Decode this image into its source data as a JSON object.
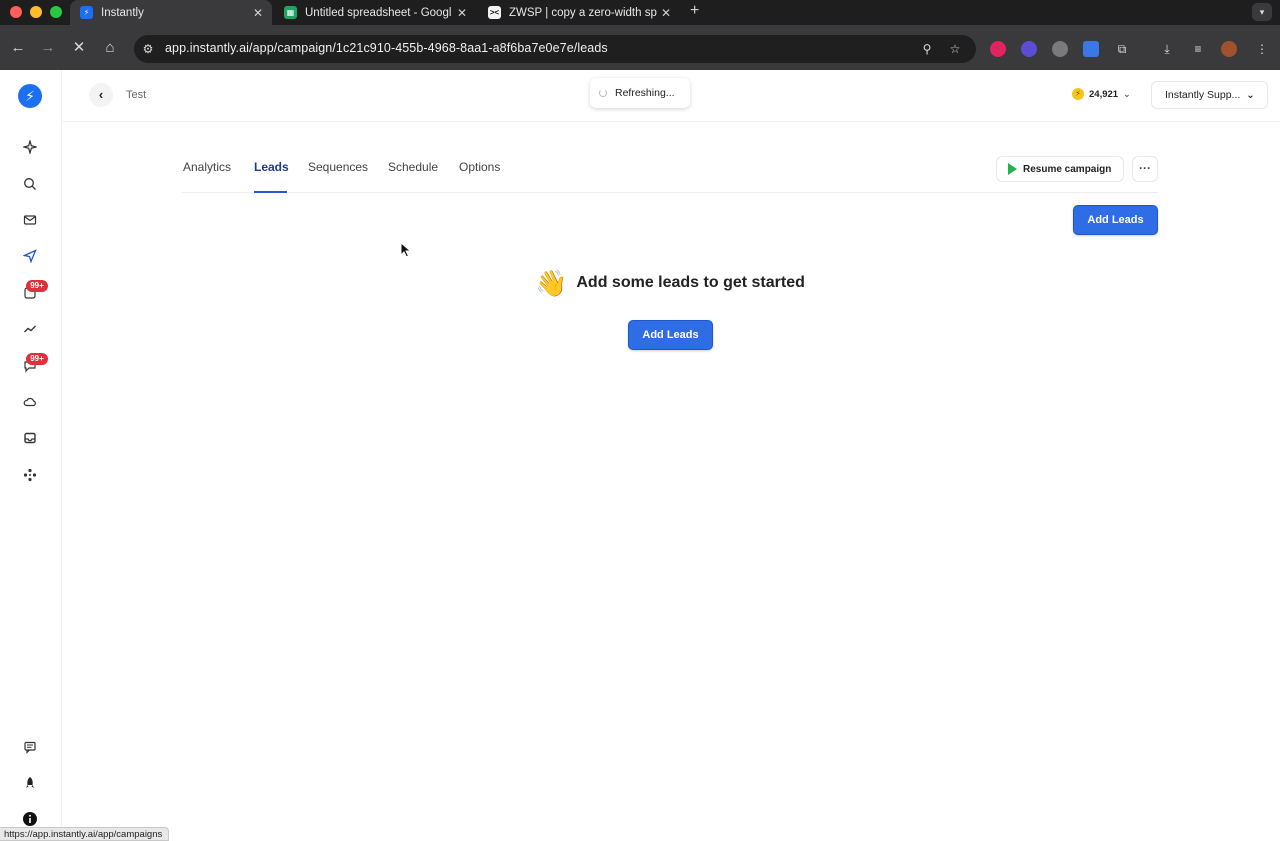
{
  "browser": {
    "tabs": [
      {
        "title": "Instantly",
        "favicon": "instantly-icon",
        "active": true
      },
      {
        "title": "Untitled spreadsheet - Googl",
        "favicon": "sheets-icon",
        "active": false
      },
      {
        "title": "ZWSP | copy a zero-width sp",
        "favicon": "zwsp-icon",
        "active": false
      }
    ],
    "new_tab": "+",
    "url": "app.instantly.ai/app/campaign/1c21c910-455b-4968-8aa1-a8f6ba7e0e7e/leads",
    "status_url": "https://app.instantly.ai/app/campaigns"
  },
  "header": {
    "breadcrumb": "Test",
    "refresh_status": "Refreshing...",
    "credits": "24,921",
    "workspace": "Instantly Supp..."
  },
  "sidebar": {
    "items": [
      {
        "icon": "sparkle-icon"
      },
      {
        "icon": "search-icon"
      },
      {
        "icon": "mail-icon"
      },
      {
        "icon": "send-icon"
      },
      {
        "icon": "unibox-icon",
        "badge": "99+"
      },
      {
        "icon": "analytics-icon"
      },
      {
        "icon": "chat-icon",
        "badge": "99+"
      },
      {
        "icon": "cloud-icon"
      },
      {
        "icon": "inbox-icon"
      },
      {
        "icon": "apps-icon"
      }
    ],
    "bottom": [
      {
        "icon": "feedback-icon"
      },
      {
        "icon": "rocket-icon"
      },
      {
        "icon": "info-icon"
      }
    ]
  },
  "campaign": {
    "tabs": [
      "Analytics",
      "Leads",
      "Sequences",
      "Schedule",
      "Options"
    ],
    "active_tab": "Leads",
    "resume_label": "Resume campaign",
    "more_label": "···",
    "add_leads_top": "Add Leads",
    "empty_emoji": "👋",
    "empty_message": "Add some leads to get started",
    "add_leads_center": "Add Leads"
  },
  "colors": {
    "primary": "#2f6de6",
    "active_tab": "#1e3a8a",
    "badge": "#e02f3a",
    "play": "#22b14c"
  }
}
